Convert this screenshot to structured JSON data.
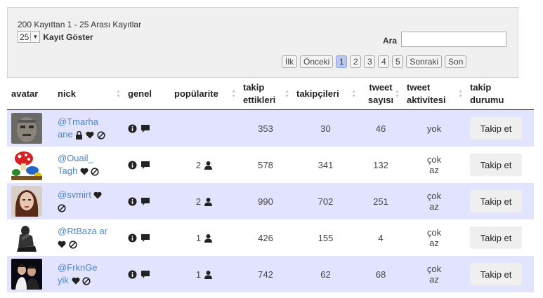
{
  "toolbar": {
    "info": "200 Kayıttan 1 - 25 Arası Kayıtlar",
    "length_value": "25",
    "length_label": "Kayıt Göster",
    "search_label": "Ara",
    "search_value": ""
  },
  "pager": {
    "first": "İlk",
    "prev": "Önceki",
    "pages": [
      "1",
      "2",
      "3",
      "4",
      "5"
    ],
    "active_page": "1",
    "next": "Sonraki",
    "last": "Son"
  },
  "columns": {
    "avatar": "avatar",
    "nick": "nick",
    "genel": "genel",
    "populerite": "popülarite",
    "takip_ettikleri": [
      "takip",
      "ettikleri"
    ],
    "takipcileri": "takipçileri",
    "tweet_sayisi": [
      "tweet",
      "sayısı"
    ],
    "tweet_aktivitesi": [
      "tweet",
      "aktivitesi"
    ],
    "takip_durumu": [
      "takip",
      "durumu"
    ]
  },
  "rows": [
    {
      "nick": [
        "@Tmarha",
        "ane"
      ],
      "icons": [
        "lock-icon",
        "heart-icon",
        "ban-icon"
      ],
      "populerite": "",
      "takip_ettikleri": "353",
      "takipcileri": "30",
      "tweet_sayisi": "46",
      "aktivite": [
        "yok"
      ],
      "button": "Takip et"
    },
    {
      "nick": [
        "@Ouail_",
        "Tagh"
      ],
      "icons": [
        "heart-icon",
        "ban-icon"
      ],
      "populerite": "2",
      "takip_ettikleri": "578",
      "takipcileri": "341",
      "tweet_sayisi": "132",
      "aktivite": [
        "çok",
        "az"
      ],
      "button": "Takip et"
    },
    {
      "nick": [
        "@svmirt"
      ],
      "icons": [
        "heart-icon",
        "ban-icon"
      ],
      "populerite": "2",
      "takip_ettikleri": "990",
      "takipcileri": "702",
      "tweet_sayisi": "251",
      "aktivite": [
        "çok",
        "az"
      ],
      "button": "Takip et"
    },
    {
      "nick": [
        "@RtBaza ar"
      ],
      "icons": [
        "heart-icon",
        "ban-icon"
      ],
      "populerite": "1",
      "takip_ettikleri": "426",
      "takipcileri": "155",
      "tweet_sayisi": "4",
      "aktivite": [
        "çok",
        "az"
      ],
      "button": "Takip et"
    },
    {
      "nick": [
        "@FrknGe",
        "yik"
      ],
      "icons": [
        "heart-icon",
        "ban-icon"
      ],
      "populerite": "1",
      "takip_ettikleri": "742",
      "takipcileri": "62",
      "tweet_sayisi": "68",
      "aktivite": [
        "çok",
        "az"
      ],
      "button": "Takip et"
    }
  ],
  "colors": {
    "row_odd": "#e2e4ff",
    "row_even": "#ffffff",
    "link": "#4a86c8",
    "active_page": "#b9c8f2"
  }
}
